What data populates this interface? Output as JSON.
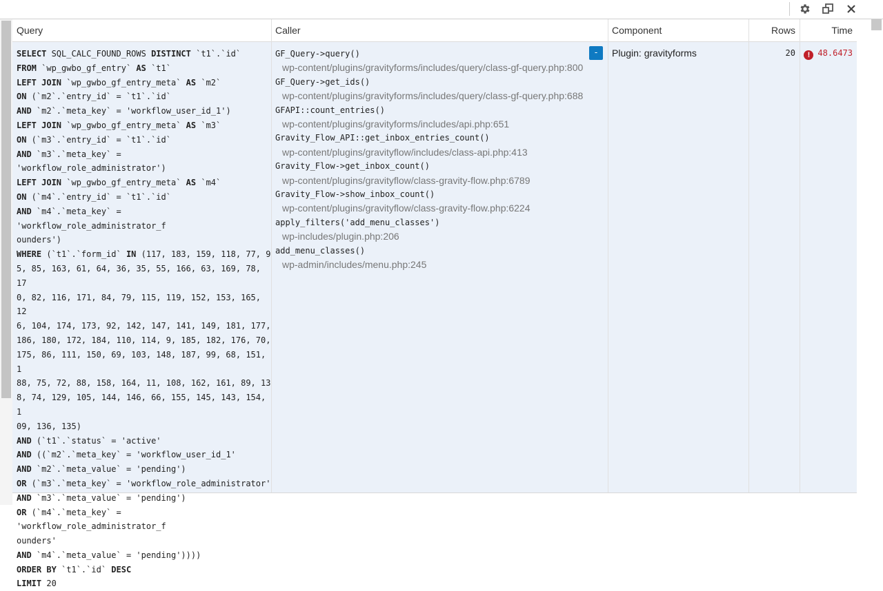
{
  "toolbar": {
    "icons": [
      "gear-icon",
      "popout-icon",
      "close-icon"
    ]
  },
  "table": {
    "headers": {
      "query": "Query",
      "caller": "Caller",
      "component": "Component",
      "rows": "Rows",
      "time": "Time"
    },
    "row": {
      "query_lines": [
        {
          "k": "SELECT",
          "t": " SQL_CALC_FOUND_ROWS ",
          "k2": "DISTINCT",
          "t2": " `t1`.`id`"
        },
        {
          "k": "FROM",
          "t": " `wp_gwbo_gf_entry` ",
          "k2": "AS",
          "t2": " `t1`"
        },
        {
          "k": "LEFT JOIN",
          "t": " `wp_gwbo_gf_entry_meta` ",
          "k2": "AS",
          "t2": " `m2`"
        },
        {
          "k": "ON",
          "t": " (`m2`.`entry_id` = `t1`.`id`"
        },
        {
          "k": "AND",
          "t": " `m2`.`meta_key` = 'workflow_user_id_1')"
        },
        {
          "k": "LEFT JOIN",
          "t": " `wp_gwbo_gf_entry_meta` ",
          "k2": "AS",
          "t2": " `m3`"
        },
        {
          "k": "ON",
          "t": " (`m3`.`entry_id` = `t1`.`id`"
        },
        {
          "k": "AND",
          "t": " `m3`.`meta_key` = 'workflow_role_administrator')"
        },
        {
          "k": "LEFT JOIN",
          "t": " `wp_gwbo_gf_entry_meta` ",
          "k2": "AS",
          "t2": " `m4`"
        },
        {
          "k": "ON",
          "t": " (`m4`.`entry_id` = `t1`.`id`"
        },
        {
          "k": "AND",
          "t": " `m4`.`meta_key` = 'workflow_role_administrator_f"
        },
        {
          "k": "",
          "t": "ounders')"
        },
        {
          "k": "WHERE",
          "t": " (`t1`.`form_id` ",
          "k2": "IN",
          "t2": " (117, 183, 159, 118, 77, 9"
        },
        {
          "k": "",
          "t": "5, 85, 163, 61, 64, 36, 35, 55, 166, 63, 169, 78, 17"
        },
        {
          "k": "",
          "t": "0, 82, 116, 171, 84, 79, 115, 119, 152, 153, 165, 12"
        },
        {
          "k": "",
          "t": "6, 104, 174, 173, 92, 142, 147, 141, 149, 181, 177,"
        },
        {
          "k": "",
          "t": "186, 180, 172, 184, 110, 114, 9, 185, 182, 176, 70,"
        },
        {
          "k": "",
          "t": "175, 86, 111, 150, 69, 103, 148, 187, 99, 68, 151, 1"
        },
        {
          "k": "",
          "t": "88, 75, 72, 88, 158, 164, 11, 108, 162, 161, 89, 13"
        },
        {
          "k": "",
          "t": "8, 74, 129, 105, 144, 146, 66, 155, 145, 143, 154, 1"
        },
        {
          "k": "",
          "t": "09, 136, 135)"
        },
        {
          "k": "AND",
          "t": " (`t1`.`status` = 'active'"
        },
        {
          "k": "AND",
          "t": " ((`m2`.`meta_key` = 'workflow_user_id_1'"
        },
        {
          "k": "AND",
          "t": " `m2`.`meta_value` = 'pending')"
        },
        {
          "k": "OR",
          "t": " (`m3`.`meta_key` = 'workflow_role_administrator'"
        },
        {
          "k": "AND",
          "t": " `m3`.`meta_value` = 'pending')"
        },
        {
          "k": "OR",
          "t": " (`m4`.`meta_key` = 'workflow_role_administrator_f"
        },
        {
          "k": "",
          "t": "ounders'"
        },
        {
          "k": "AND",
          "t": " `m4`.`meta_value` = 'pending'))))"
        },
        {
          "k": "ORDER BY",
          "t": " `t1`.`id` ",
          "k2": "DESC",
          "t2": ""
        },
        {
          "k": "LIMIT",
          "t": " 20"
        }
      ],
      "callers": [
        {
          "fn": "GF_Query->query()",
          "path": "wp-content/plugins/gravityforms/includes/query/class-gf-query.php:800"
        },
        {
          "fn": "GF_Query->get_ids()",
          "path": "wp-content/plugins/gravityforms/includes/query/class-gf-query.php:688"
        },
        {
          "fn": "GFAPI::count_entries()",
          "path": "wp-content/plugins/gravityforms/includes/api.php:651"
        },
        {
          "fn": "Gravity_Flow_API::get_inbox_entries_count()",
          "path": "wp-content/plugins/gravityflow/includes/class-api.php:413"
        },
        {
          "fn": "Gravity_Flow->get_inbox_count()",
          "path": "wp-content/plugins/gravityflow/class-gravity-flow.php:6789"
        },
        {
          "fn": "Gravity_Flow->show_inbox_count()",
          "path": "wp-content/plugins/gravityflow/class-gravity-flow.php:6224"
        },
        {
          "fn": "apply_filters('add_menu_classes')",
          "path": "wp-includes/plugin.php:206"
        },
        {
          "fn": "add_menu_classes()",
          "path": "wp-admin/includes/menu.php:245"
        }
      ],
      "toggle_label": "-",
      "component": "Plugin: gravityforms",
      "rows": "20",
      "time": "48.6473",
      "time_warning_glyph": "!"
    }
  },
  "colors": {
    "row_bg": "#ebf1f9",
    "toggle_bg": "#0f7ac2",
    "time_color": "#c0202a",
    "path_color": "#777777"
  }
}
